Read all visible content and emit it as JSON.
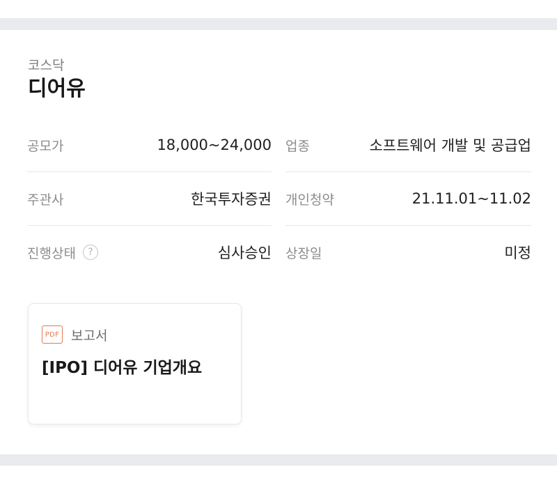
{
  "header": {
    "market": "코스닥",
    "company": "디어유"
  },
  "info": {
    "offer_price_label": "공모가",
    "offer_price_value": "18,000~24,000",
    "industry_label": "업종",
    "industry_value": "소프트웨어 개발 및 공급업",
    "underwriter_label": "주관사",
    "underwriter_value": "한국투자증권",
    "subscription_label": "개인청약",
    "subscription_value": "21.11.01~11.02",
    "status_label": "진행상태",
    "status_value": "심사승인",
    "listing_label": "상장일",
    "listing_value": "미정"
  },
  "icons": {
    "help": "?",
    "pdf": "PDF"
  },
  "report": {
    "type_label": "보고서",
    "title": "[IPO] 디어유 기업개요"
  },
  "colors": {
    "background": "#ffffff",
    "band": "#e9ebee",
    "pdf_accent": "#e07a50",
    "label_gray": "#8c8c8c"
  }
}
